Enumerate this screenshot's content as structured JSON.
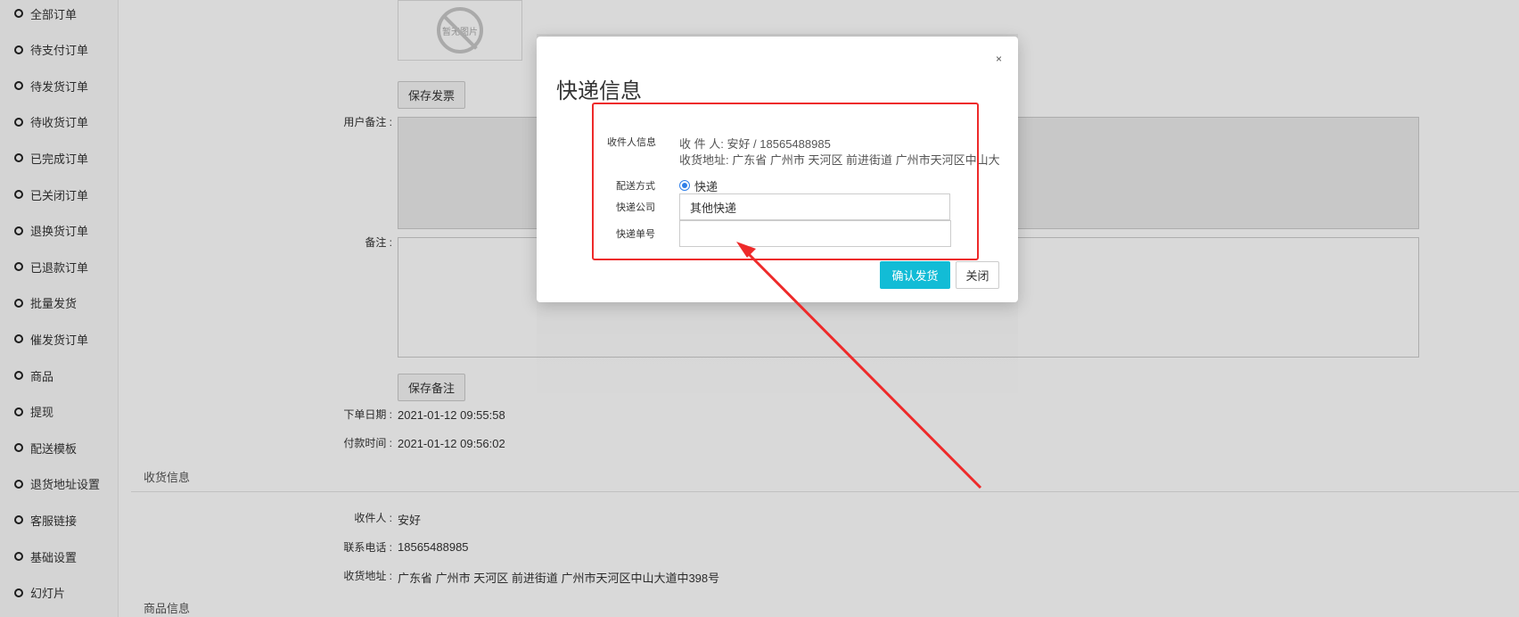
{
  "sidebar": {
    "items": [
      {
        "label": "全部订单"
      },
      {
        "label": "待支付订单"
      },
      {
        "label": "待发货订单"
      },
      {
        "label": "待收货订单"
      },
      {
        "label": "已完成订单"
      },
      {
        "label": "已关闭订单"
      },
      {
        "label": "退换货订单"
      },
      {
        "label": "已退款订单"
      },
      {
        "label": "批量发货"
      },
      {
        "label": "催发货订单"
      },
      {
        "label": "商品"
      },
      {
        "label": "提现"
      },
      {
        "label": "配送模板"
      },
      {
        "label": "退货地址设置"
      },
      {
        "label": "客服链接"
      },
      {
        "label": "基础设置"
      },
      {
        "label": "幻灯片"
      }
    ]
  },
  "page": {
    "image_placeholder_text": "暂无图片",
    "save_invoice_label": "保存发票",
    "user_remark_label": "用户备注 :",
    "remark_label": "备注 :",
    "save_remark_label": "保存备注",
    "order_date_label": "下单日期 :",
    "order_date_value": "2021-01-12 09:55:58",
    "pay_time_label": "付款时间 :",
    "pay_time_value": "2021-01-12 09:56:02",
    "shipping_section_title": "收货信息",
    "receiver_label": "收件人 :",
    "receiver_value": "安好",
    "phone_label": "联系电话 :",
    "phone_value": "18565488985",
    "address_label": "收货地址 :",
    "address_value": "广东省 广州市 天河区 前进街道 广州市天河区中山大道中398号",
    "goods_section_title": "商品信息"
  },
  "modal": {
    "title": "快递信息",
    "close_glyph": "×",
    "recipient_info_label": "收件人信息",
    "recipient_line": "收 件 人: 安好 / 18565488985",
    "address_line": "收货地址: 广东省 广州市 天河区 前进街道 广州市天河区中山大道",
    "delivery_method_label": "配送方式",
    "delivery_method_option": "快递",
    "courier_label": "快递公司",
    "courier_value": "其他快递",
    "tracking_label": "快递单号",
    "tracking_value": "",
    "confirm_label": "确认发货",
    "close_label": "关闭"
  },
  "colors": {
    "accent": "#12bcd6",
    "annotation": "#ee2a2a",
    "radio": "#2f7fe8"
  }
}
